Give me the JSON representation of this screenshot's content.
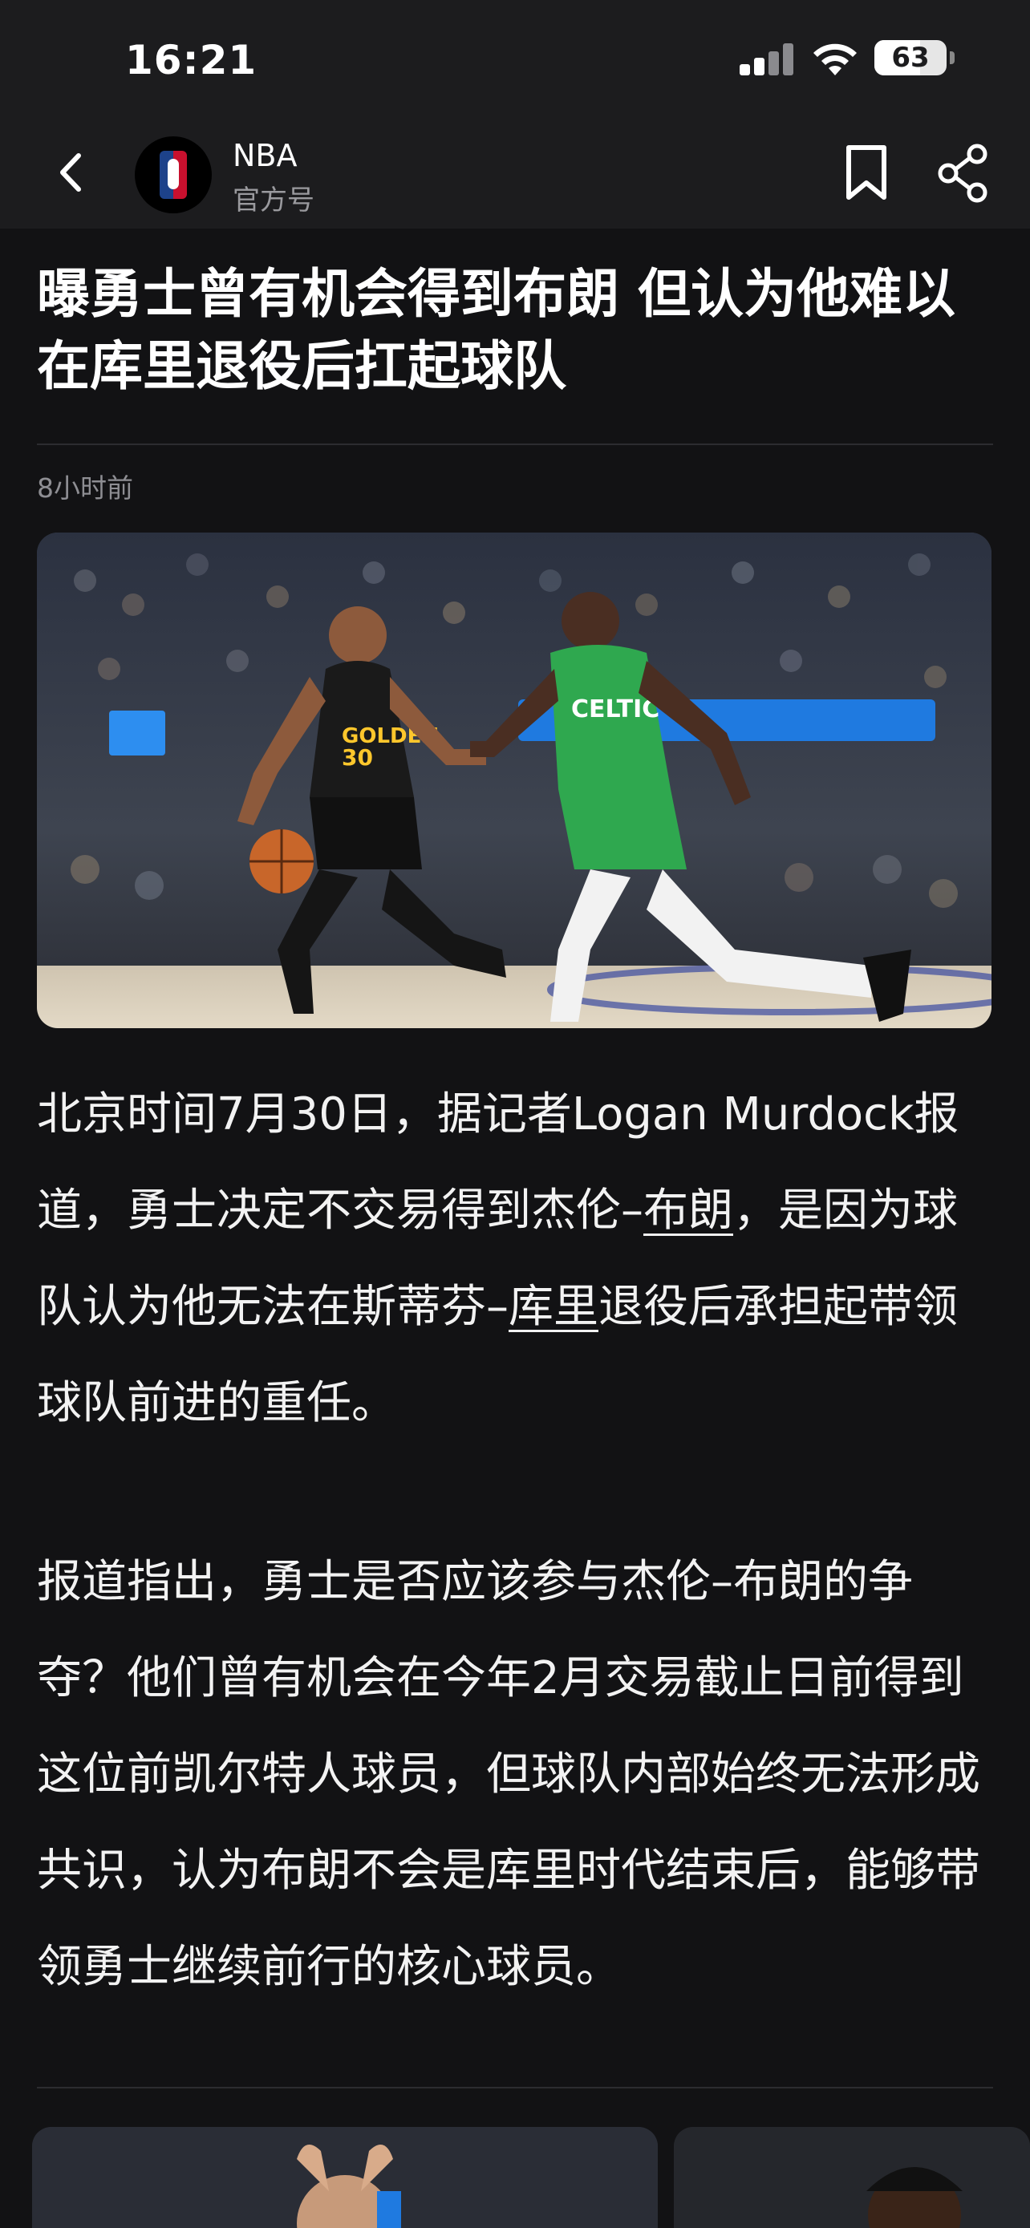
{
  "status_bar": {
    "time": "16:21",
    "battery": "63",
    "battery_level": 0.63
  },
  "header": {
    "source_name": "NBA",
    "source_type": "官方号"
  },
  "article": {
    "title": "曝勇士曾有机会得到布朗  但认为他难以在库里退役后扛起球队",
    "published": "8小时前",
    "p1_text1": "北京时间7月30日，据记者Logan Murdock报道，勇士决定不交易得到杰伦–",
    "p1_link1": "布朗",
    "p1_text2": "，是因为球队认为他无法在斯蒂芬–",
    "p1_link2": "库里",
    "p1_text3": "退役后承担起带领球队前进的重任。",
    "p2": "报道指出，勇士是否应该参与杰伦–布朗的争夺？他们曾有机会在今年2月交易截止日前得到这位前凯尔特人球员，但球队内部始终无法形成共识，认为布朗不会是库里时代结束后，能够带领勇士继续前行的核心球员。"
  },
  "colors": {
    "background": "#121214",
    "bar": "#1c1c1e",
    "warriors_jersey": "#1a1a1a",
    "warriors_gold": "#ffc72c",
    "celtics_green": "#2fa84f",
    "arena_blue": "#1f7ae0"
  },
  "icons": [
    "back-icon",
    "nba-logo-icon",
    "bookmark-icon",
    "share-icon",
    "signal-icon",
    "wifi-icon",
    "battery-icon"
  ]
}
